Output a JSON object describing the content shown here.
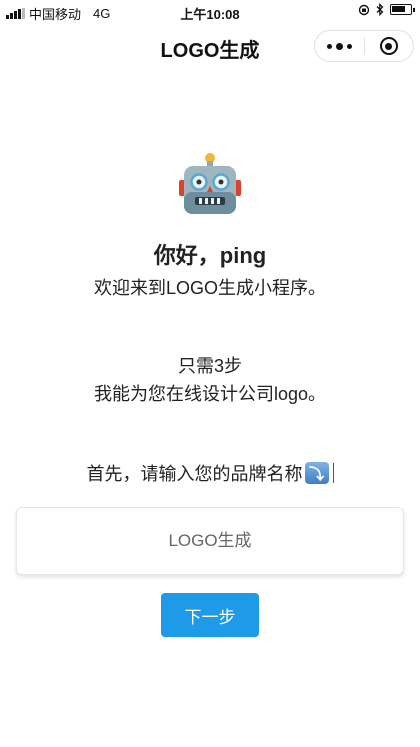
{
  "status_bar": {
    "carrier": "中国移动",
    "network": "4G",
    "time": "上午10:08"
  },
  "nav": {
    "title": "LOGO生成"
  },
  "content": {
    "greeting": "你好，ping",
    "welcome": "欢迎来到LOGO生成小程序。",
    "steps": "只需3步",
    "description": "我能为您在线设计公司logo。",
    "prompt": "首先，请输入您的品牌名称",
    "prompt_icon": "right-arrow-curving-down-icon"
  },
  "form": {
    "brand_input_placeholder": "LOGO生成",
    "brand_input_value": "",
    "next_label": "下一步"
  },
  "colors": {
    "primary_button": "#1d9be8",
    "background": "#ffffff"
  }
}
